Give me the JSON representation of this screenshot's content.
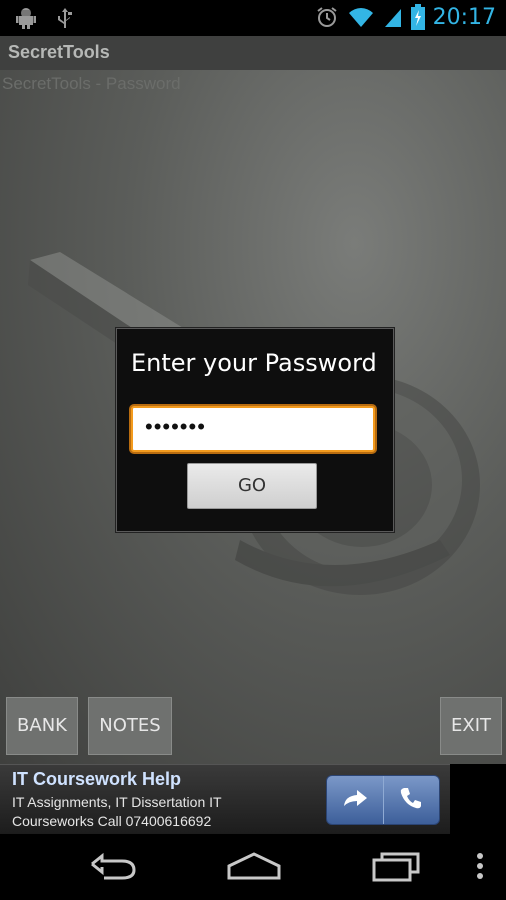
{
  "status_bar": {
    "time": "20:17"
  },
  "app": {
    "title": "SecretTools",
    "subtitle": "SecretTools - Password"
  },
  "dialog": {
    "title": "Enter your Password",
    "password_value": "•••••••",
    "go_label": "GO"
  },
  "buttons": {
    "bank": "BANK",
    "notes": "NOTES",
    "exit": "EXIT"
  },
  "ad": {
    "headline": "IT Coursework Help",
    "body": "IT Assignments, IT Dissertation IT Courseworks Call 07400616692"
  },
  "colors": {
    "accent_time": "#33b5e5",
    "field_focus": "#f39b1e",
    "ad_actions": "#4f6fa8"
  }
}
